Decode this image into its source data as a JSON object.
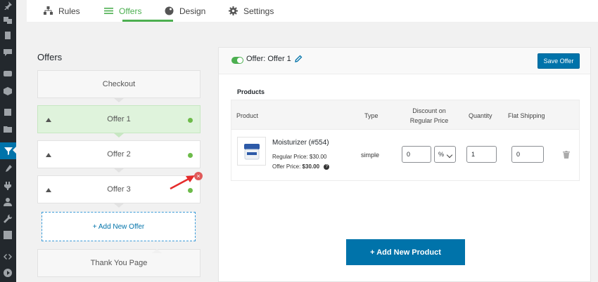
{
  "tabs": [
    {
      "label": "Rules",
      "icon": "sitemap-icon"
    },
    {
      "label": "Offers",
      "icon": "list-icon",
      "active": true
    },
    {
      "label": "Design",
      "icon": "palette-icon"
    },
    {
      "label": "Settings",
      "icon": "gear-icon"
    }
  ],
  "funnel": {
    "title": "Offers",
    "steps": [
      {
        "label": "Checkout"
      },
      {
        "label": "Offer 1",
        "active": true
      },
      {
        "label": "Offer 2"
      },
      {
        "label": "Offer 3"
      }
    ],
    "add_offer_label": "+ Add New Offer",
    "thank_you_label": "Thank You Page"
  },
  "offer_panel": {
    "offer_label": "Offer: Offer 1",
    "save_label": "Save Offer",
    "products_label": "Products",
    "columns": {
      "product": "Product",
      "type": "Type",
      "discount": "Discount on Regular Price",
      "quantity": "Quantity",
      "shipping": "Flat Shipping"
    },
    "product": {
      "name": "Moisturizer (#554)",
      "regular_price": "Regular Price: $30.00",
      "offer_price_label": "Offer Price:",
      "offer_price_value": "$30.00",
      "type": "simple",
      "discount_value": "0",
      "discount_unit": "%",
      "quantity_value": "1",
      "shipping_value": "0"
    },
    "add_product_label": "+ Add New Product"
  },
  "colors": {
    "accent_green": "#4caf50",
    "primary_blue": "#0073aa",
    "active_step_bg": "#dff3dc",
    "remove_red": "#e05a5a"
  }
}
